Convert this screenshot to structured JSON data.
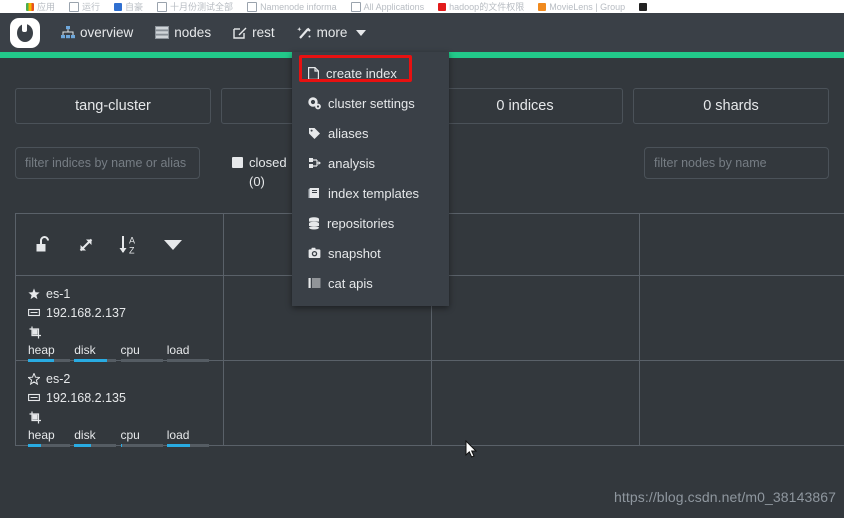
{
  "browser": {
    "bookmarks": [
      {
        "label": "应用",
        "icon": "colored-squares-icon"
      },
      {
        "label": "运行",
        "icon": "blank-icon"
      },
      {
        "label": "自豪",
        "icon": "blue-square-icon"
      },
      {
        "label": "十月份测试全部",
        "icon": "blank-icon"
      },
      {
        "label": "Namenode informa",
        "icon": "blank-icon"
      },
      {
        "label": "All Applications",
        "icon": "blank-icon"
      },
      {
        "label": "hadoop的文件权限",
        "icon": "red-icon"
      },
      {
        "label": "MovieLens | Group",
        "icon": "orange-icon"
      },
      {
        "label": "",
        "icon": "dark-icon"
      }
    ]
  },
  "navbar": {
    "logo_name": "cerebro-logo",
    "items": [
      {
        "label": "overview",
        "icon": "sitemap-icon",
        "id": "overview"
      },
      {
        "label": "nodes",
        "icon": "server-icon",
        "id": "nodes"
      },
      {
        "label": "rest",
        "icon": "pencil-square-icon",
        "id": "rest"
      },
      {
        "label": "more",
        "icon": "magic-wand-icon",
        "id": "more",
        "has_caret": true
      }
    ]
  },
  "health": {
    "status": "green",
    "color": "#22c98a"
  },
  "stats": [
    {
      "label": "tang-cluster",
      "name": "cluster-name-card"
    },
    {
      "label": "",
      "name": "nodes-count-card"
    },
    {
      "label": "0 indices",
      "name": "indices-count-card"
    },
    {
      "label": "0 shards",
      "name": "shards-count-card"
    }
  ],
  "filters": {
    "indices_placeholder": "filter indices by name or alias",
    "indices_value": "",
    "closed_label": "closed",
    "closed_count": "(0)",
    "closed_checked": false,
    "nodes_placeholder": "filter nodes by name",
    "nodes_value": ""
  },
  "toolbar": {
    "buttons": [
      {
        "name": "unlock-icon",
        "title": "unlock"
      },
      {
        "name": "expand-arrows-icon",
        "title": "expand"
      },
      {
        "name": "sort-alpha-down-icon",
        "title": "sort a-z"
      },
      {
        "name": "chevron-down-icon",
        "title": "more options"
      }
    ]
  },
  "nodes": [
    {
      "name": "es-1",
      "master": true,
      "star_icon": "star-filled-icon",
      "host_icon": "server-rack-icon",
      "ip": "192.168.2.137",
      "role_icon": "data-node-icon",
      "metrics": [
        {
          "label": "heap",
          "percent": 62
        },
        {
          "label": "disk",
          "percent": 78
        },
        {
          "label": "cpu",
          "percent": 0
        },
        {
          "label": "load",
          "percent": 0
        }
      ]
    },
    {
      "name": "es-2",
      "master": false,
      "star_icon": "star-outline-icon",
      "host_icon": "server-rack-icon",
      "ip": "192.168.2.135",
      "role_icon": "data-node-icon",
      "metrics": [
        {
          "label": "heap",
          "percent": 30
        },
        {
          "label": "disk",
          "percent": 40
        },
        {
          "label": "cpu",
          "percent": 3
        },
        {
          "label": "load",
          "percent": 55
        }
      ]
    }
  ],
  "more_menu": {
    "open": true,
    "highlight_color": "#e81111",
    "items": [
      {
        "label": "create index",
        "icon": "file-icon",
        "highlighted": true
      },
      {
        "label": "cluster settings",
        "icon": "gears-icon",
        "highlighted": false
      },
      {
        "label": "aliases",
        "icon": "tag-icon",
        "highlighted": false
      },
      {
        "label": "analysis",
        "icon": "analysis-icon",
        "highlighted": false
      },
      {
        "label": "index templates",
        "icon": "book-icon",
        "highlighted": false
      },
      {
        "label": "repositories",
        "icon": "database-icon",
        "highlighted": false
      },
      {
        "label": "snapshot",
        "icon": "camera-icon",
        "highlighted": false
      },
      {
        "label": "cat apis",
        "icon": "list-icon",
        "highlighted": false
      }
    ]
  },
  "watermark": "https://blog.csdn.net/m0_38143867"
}
